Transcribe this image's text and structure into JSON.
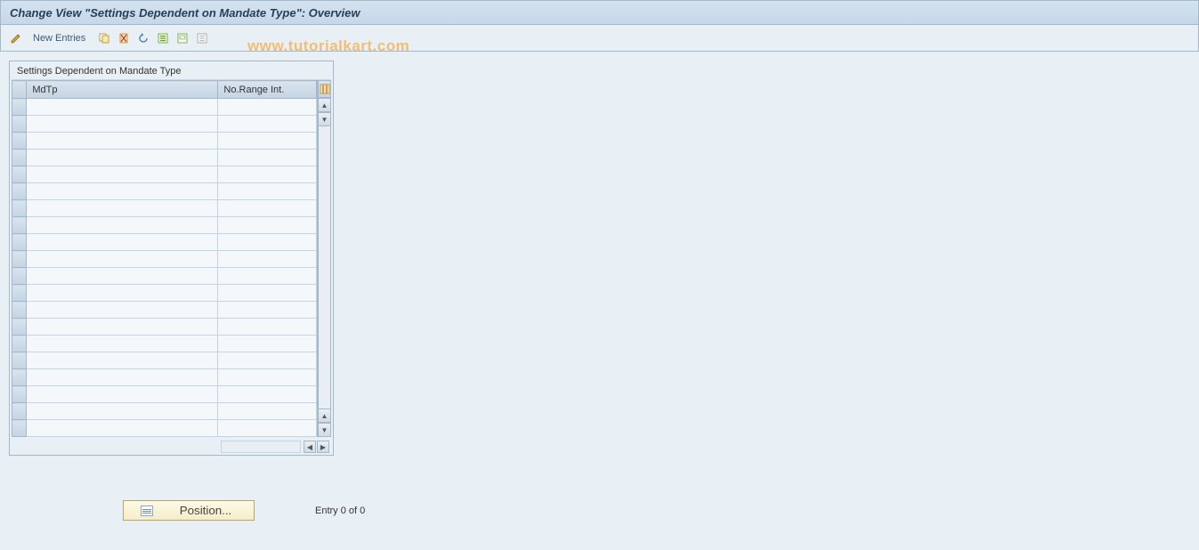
{
  "title": "Change View \"Settings Dependent on Mandate Type\": Overview",
  "toolbar": {
    "new_entries": "New Entries"
  },
  "table": {
    "caption": "Settings Dependent on Mandate Type",
    "columns": {
      "mdtp": "MdTp",
      "range": "No.Range Int."
    },
    "rows": [
      {
        "mdtp": "",
        "range": ""
      },
      {
        "mdtp": "",
        "range": ""
      },
      {
        "mdtp": "",
        "range": ""
      },
      {
        "mdtp": "",
        "range": ""
      },
      {
        "mdtp": "",
        "range": ""
      },
      {
        "mdtp": "",
        "range": ""
      },
      {
        "mdtp": "",
        "range": ""
      },
      {
        "mdtp": "",
        "range": ""
      },
      {
        "mdtp": "",
        "range": ""
      },
      {
        "mdtp": "",
        "range": ""
      },
      {
        "mdtp": "",
        "range": ""
      },
      {
        "mdtp": "",
        "range": ""
      },
      {
        "mdtp": "",
        "range": ""
      },
      {
        "mdtp": "",
        "range": ""
      },
      {
        "mdtp": "",
        "range": ""
      },
      {
        "mdtp": "",
        "range": ""
      },
      {
        "mdtp": "",
        "range": ""
      },
      {
        "mdtp": "",
        "range": ""
      },
      {
        "mdtp": "",
        "range": ""
      },
      {
        "mdtp": "",
        "range": ""
      }
    ]
  },
  "footer": {
    "position_label": "Position...",
    "entry_text": "Entry 0 of 0"
  },
  "watermark": "www.tutorialkart.com"
}
